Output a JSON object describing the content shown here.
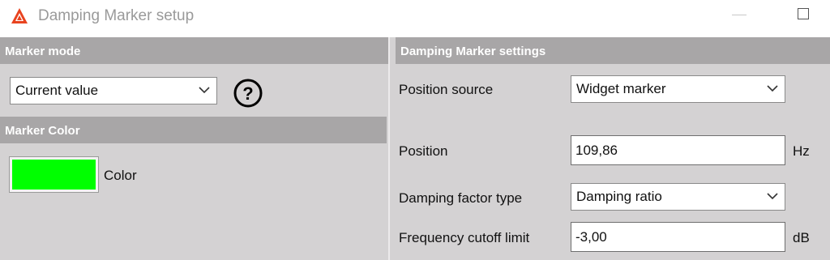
{
  "window": {
    "title": "Damping Marker setup",
    "icon": "app-logo-icon"
  },
  "left": {
    "marker_mode_header": "Marker mode",
    "marker_mode_value": "Current value",
    "help_icon": "question-mark-icon",
    "marker_color_header": "Marker Color",
    "color_label": "Color",
    "color_value": "#00ff00"
  },
  "right": {
    "settings_header": "Damping Marker settings",
    "position_source_label": "Position source",
    "position_source_value": "Widget marker",
    "position_label": "Position",
    "position_value": "109,86",
    "position_unit": "Hz",
    "damping_factor_type_label": "Damping factor type",
    "damping_factor_type_value": "Damping ratio",
    "frequency_cutoff_label": "Frequency cutoff limit",
    "frequency_cutoff_value": "-3,00",
    "frequency_cutoff_unit": "dB"
  },
  "colors": {
    "header_bg": "#a8a6a7",
    "panel_bg": "#d4d2d3",
    "swatch": "#00ff00"
  }
}
